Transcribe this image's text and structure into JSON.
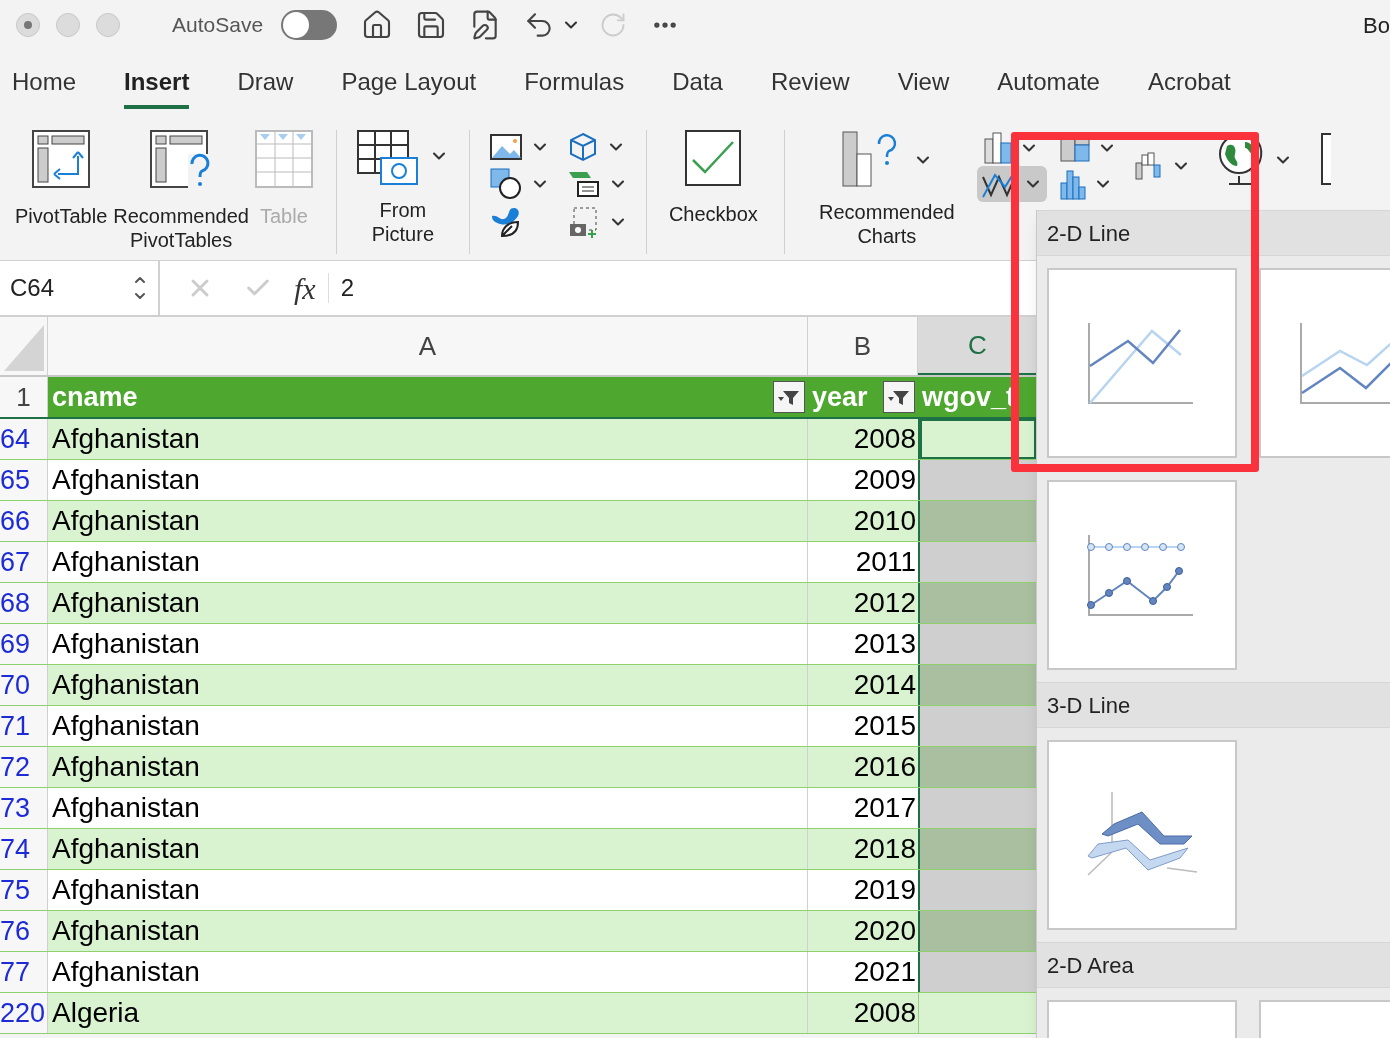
{
  "window": {
    "title": "Bo",
    "autosave_label": "AutoSave",
    "autosave_on": false
  },
  "tabs": [
    {
      "label": "Home",
      "selected": false
    },
    {
      "label": "Insert",
      "selected": true
    },
    {
      "label": "Draw",
      "selected": false
    },
    {
      "label": "Page Layout",
      "selected": false
    },
    {
      "label": "Formulas",
      "selected": false
    },
    {
      "label": "Data",
      "selected": false
    },
    {
      "label": "Review",
      "selected": false
    },
    {
      "label": "View",
      "selected": false
    },
    {
      "label": "Automate",
      "selected": false
    },
    {
      "label": "Acrobat",
      "selected": false
    }
  ],
  "ribbon": {
    "tables": [
      {
        "kind": "pivot",
        "label": "PivotTable",
        "disabled": false
      },
      {
        "kind": "recommended-pivot",
        "label": "Recommended\nPivotTables",
        "disabled": false
      },
      {
        "kind": "table",
        "label": "Table",
        "disabled": true
      }
    ],
    "picture": {
      "label": "From\nPicture"
    },
    "checkbox": {
      "label": "Checkbox"
    },
    "recommended_charts": {
      "label": "Recommended\nCharts"
    },
    "chart_buttons": [
      {
        "kind": "column",
        "pressed": false
      },
      {
        "kind": "hierarchy",
        "pressed": false
      },
      {
        "kind": "waterfall",
        "pressed": false
      },
      {
        "kind": "line",
        "pressed": true
      },
      {
        "kind": "statistic",
        "pressed": false
      }
    ]
  },
  "formula_bar": {
    "name_box": "C64",
    "function_label": "fx",
    "value": "2"
  },
  "grid": {
    "columns": [
      {
        "letter": "A",
        "selected": false
      },
      {
        "letter": "B",
        "selected": false
      },
      {
        "letter": "C",
        "selected": true
      }
    ],
    "header": {
      "row": "1",
      "cells": [
        {
          "text": "cname",
          "filter": true
        },
        {
          "text": "year",
          "filter": true
        },
        {
          "text": "wgov_t",
          "filter": false
        }
      ]
    },
    "rows": [
      {
        "row": "64",
        "cname": "Afghanistan",
        "year": "2008",
        "selected": true,
        "active": true
      },
      {
        "row": "65",
        "cname": "Afghanistan",
        "year": "2009",
        "selected": true,
        "active": false
      },
      {
        "row": "66",
        "cname": "Afghanistan",
        "year": "2010",
        "selected": true,
        "active": false
      },
      {
        "row": "67",
        "cname": "Afghanistan",
        "year": "2011",
        "selected": true,
        "active": false
      },
      {
        "row": "68",
        "cname": "Afghanistan",
        "year": "2012",
        "selected": true,
        "active": false
      },
      {
        "row": "69",
        "cname": "Afghanistan",
        "year": "2013",
        "selected": true,
        "active": false
      },
      {
        "row": "70",
        "cname": "Afghanistan",
        "year": "2014",
        "selected": true,
        "active": false
      },
      {
        "row": "71",
        "cname": "Afghanistan",
        "year": "2015",
        "selected": true,
        "active": false
      },
      {
        "row": "72",
        "cname": "Afghanistan",
        "year": "2016",
        "selected": true,
        "active": false
      },
      {
        "row": "73",
        "cname": "Afghanistan",
        "year": "2017",
        "selected": true,
        "active": false
      },
      {
        "row": "74",
        "cname": "Afghanistan",
        "year": "2018",
        "selected": true,
        "active": false
      },
      {
        "row": "75",
        "cname": "Afghanistan",
        "year": "2019",
        "selected": true,
        "active": false
      },
      {
        "row": "76",
        "cname": "Afghanistan",
        "year": "2020",
        "selected": true,
        "active": false
      },
      {
        "row": "77",
        "cname": "Afghanistan",
        "year": "2021",
        "selected": true,
        "active": false
      },
      {
        "row": "220",
        "cname": "Algeria",
        "year": "2008",
        "selected": false,
        "active": false
      }
    ]
  },
  "chart_menu": {
    "sections": [
      {
        "title": "2-D Line",
        "items": [
          {
            "kind": "line",
            "highlighted": true
          },
          {
            "kind": "stacked-line",
            "highlighted": false
          },
          {
            "kind": "line-markers",
            "highlighted": false
          }
        ]
      },
      {
        "title": "3-D Line",
        "items": [
          {
            "kind": "line3d",
            "highlighted": false
          }
        ]
      },
      {
        "title": "2-D Area",
        "items": [
          {
            "kind": "area",
            "highlighted": false
          },
          {
            "kind": "stacked-area",
            "highlighted": false
          }
        ]
      }
    ]
  }
}
